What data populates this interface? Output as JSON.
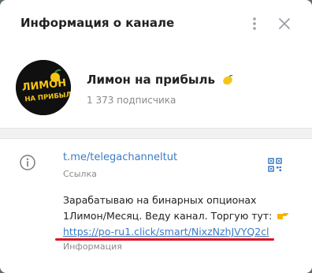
{
  "dialog": {
    "title": "Информация о канале",
    "more_icon": "more-vertical-icon",
    "close_icon": "close-icon"
  },
  "channel": {
    "name": "Лимон на прибыль",
    "name_emoji": "lemon-icon",
    "subscribers": "1 373 подписчика",
    "avatar": {
      "logo_line1": "ЛИМОН",
      "logo_line2": "НА ПРИБЫЛЬ"
    }
  },
  "info": {
    "link": "t.me/telegachanneltut",
    "link_label": "Ссылка",
    "description_line1": "Зарабатываю на бинарных опционах",
    "description_line2": "1Лимон/Месяц. Веду канал. Торгую тут:",
    "description_link": "https://po-ru1.click/smart/NixzNzhJVYQ2cl",
    "description_label": "Информация",
    "hand_icon": "pointing-hand-icon",
    "info_icon": "info-icon",
    "qr_icon": "qr-code-icon"
  },
  "colors": {
    "link": "#3a7cc4",
    "highlight": "#e0141e",
    "avatar_text": "#f5c518"
  }
}
